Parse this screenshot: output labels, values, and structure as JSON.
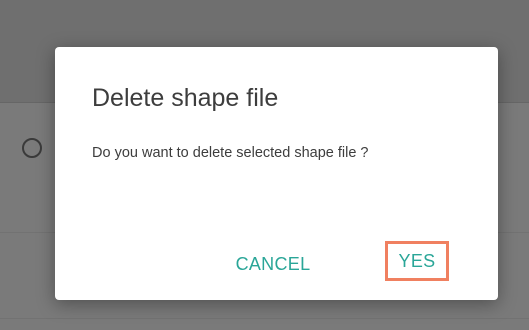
{
  "background": {
    "colors": {
      "overlay": "#7a7a7a",
      "header_band": "#6f6f6f"
    },
    "radio_icon": "radio-unchecked-icon"
  },
  "dialog": {
    "title": "Delete shape file",
    "message": "Do you want to delete selected shape file ?",
    "cancel_label": "CANCEL",
    "yes_label": "YES",
    "colors": {
      "accent": "#2aa698",
      "highlight": "#f08060",
      "text": "#3d3d3d"
    }
  }
}
